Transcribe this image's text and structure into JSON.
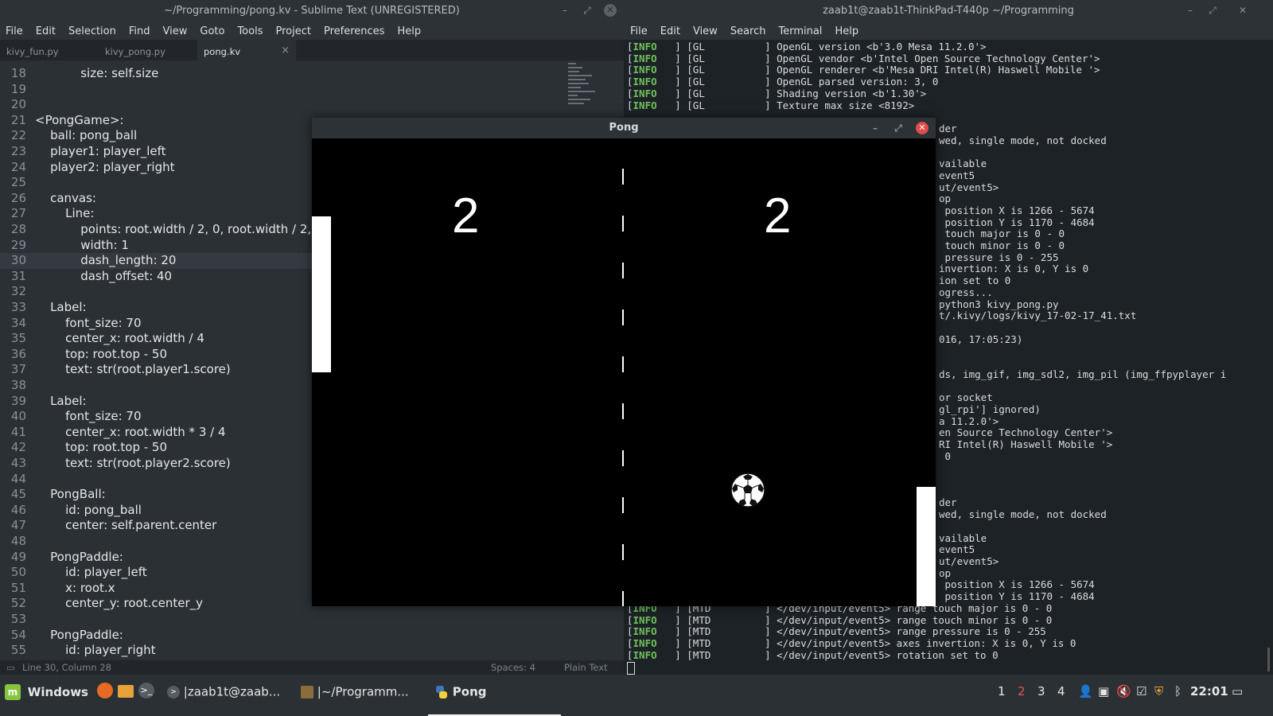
{
  "sublime": {
    "title": "~/Programming/pong.kv - Sublime Text (UNREGISTERED)",
    "menu": [
      "File",
      "Edit",
      "Selection",
      "Find",
      "View",
      "Goto",
      "Tools",
      "Project",
      "Preferences",
      "Help"
    ],
    "tabs": [
      {
        "label": "kivy_fun.py",
        "active": false
      },
      {
        "label": "kivy_pong.py",
        "active": false
      },
      {
        "label": "pong.kv",
        "active": true
      }
    ],
    "current_line": 30,
    "lines": [
      {
        "n": "18",
        "t": "            size: self.size"
      },
      {
        "n": "19",
        "t": ""
      },
      {
        "n": "20",
        "t": ""
      },
      {
        "n": "21",
        "t": "<PongGame>:"
      },
      {
        "n": "22",
        "t": "    ball: pong_ball"
      },
      {
        "n": "23",
        "t": "    player1: player_left"
      },
      {
        "n": "24",
        "t": "    player2: player_right"
      },
      {
        "n": "25",
        "t": ""
      },
      {
        "n": "26",
        "t": "    canvas:"
      },
      {
        "n": "27",
        "t": "        Line:"
      },
      {
        "n": "28",
        "t": "            points: root.width / 2, 0, root.width / 2,"
      },
      {
        "n": "29",
        "t": "            width: 1"
      },
      {
        "n": "30",
        "t": "            dash_length: 20"
      },
      {
        "n": "31",
        "t": "            dash_offset: 40"
      },
      {
        "n": "32",
        "t": ""
      },
      {
        "n": "33",
        "t": "    Label:"
      },
      {
        "n": "34",
        "t": "        font_size: 70"
      },
      {
        "n": "35",
        "t": "        center_x: root.width / 4"
      },
      {
        "n": "36",
        "t": "        top: root.top - 50"
      },
      {
        "n": "37",
        "t": "        text: str(root.player1.score)"
      },
      {
        "n": "38",
        "t": ""
      },
      {
        "n": "39",
        "t": "    Label:"
      },
      {
        "n": "40",
        "t": "        font_size: 70"
      },
      {
        "n": "41",
        "t": "        center_x: root.width * 3 / 4"
      },
      {
        "n": "42",
        "t": "        top: root.top - 50"
      },
      {
        "n": "43",
        "t": "        text: str(root.player2.score)"
      },
      {
        "n": "44",
        "t": ""
      },
      {
        "n": "45",
        "t": "    PongBall:"
      },
      {
        "n": "46",
        "t": "        id: pong_ball"
      },
      {
        "n": "47",
        "t": "        center: self.parent.center"
      },
      {
        "n": "48",
        "t": ""
      },
      {
        "n": "49",
        "t": "    PongPaddle:"
      },
      {
        "n": "50",
        "t": "        id: player_left"
      },
      {
        "n": "51",
        "t": "        x: root.x"
      },
      {
        "n": "52",
        "t": "        center_y: root.center_y"
      },
      {
        "n": "53",
        "t": ""
      },
      {
        "n": "54",
        "t": "    PongPaddle:"
      },
      {
        "n": "55",
        "t": "        id: player_right"
      }
    ],
    "status": {
      "position": "Line 30, Column 28",
      "spaces": "Spaces: 4",
      "syntax": "Plain Text"
    }
  },
  "terminal": {
    "title": "zaab1t@zaab1t-ThinkPad-T440p ~/Programming",
    "menu": [
      "File",
      "Edit",
      "View",
      "Search",
      "Terminal",
      "Help"
    ],
    "top_lines": [
      {
        "tag": "INFO",
        "rest": "   ] [GL          ] OpenGL version <b'3.0 Mesa 11.2.0'>"
      },
      {
        "tag": "INFO",
        "rest": "   ] [GL          ] OpenGL vendor <b'Intel Open Source Technology Center'>"
      },
      {
        "tag": "INFO",
        "rest": "   ] [GL          ] OpenGL renderer <b'Mesa DRI Intel(R) Haswell Mobile '>"
      },
      {
        "tag": "INFO",
        "rest": "   ] [GL          ] OpenGL parsed version: 3, 0"
      },
      {
        "tag": "INFO",
        "rest": "   ] [GL          ] Shading version <b'1.30'>"
      },
      {
        "tag": "INFO",
        "rest": "   ] [GL          ] Texture max size <8192>"
      }
    ],
    "right_fragments": [
      "der",
      "wed, single mode, not docked",
      "",
      "vailable",
      "event5",
      "ut/event5>",
      "op",
      " position X is 1266 - 5674",
      " position Y is 1170 - 4684",
      " touch major is 0 - 0",
      " touch minor is 0 - 0",
      " pressure is 0 - 255",
      "invertion: X is 0, Y is 0",
      "ion set to 0",
      "ogress...",
      "python3 kivy_pong.py",
      "t/.kivy/logs/kivy_17-02-17_41.txt",
      "",
      "016, 17:05:23)",
      "",
      "",
      "ds, img_gif, img_sdl2, img_pil (img_ffpyplayer i",
      "",
      "or socket",
      "gl_rpi'] ignored)",
      "a 11.2.0'>",
      "en Source Technology Center'>",
      "RI Intel(R) Haswell Mobile '>",
      " 0",
      "",
      "",
      "",
      "der",
      "wed, single mode, not docked",
      "",
      "vailable",
      "event5",
      "ut/event5>",
      "op",
      " position X is 1266 - 5674",
      " position Y is 1170 - 4684"
    ],
    "bottom_lines": [
      {
        "tag": "INFO",
        "rest": "   ] [MTD         ] </dev/input/event5> range touch major is 0 - 0"
      },
      {
        "tag": "INFO",
        "rest": "   ] [MTD         ] </dev/input/event5> range touch minor is 0 - 0"
      },
      {
        "tag": "INFO",
        "rest": "   ] [MTD         ] </dev/input/event5> range pressure is 0 - 255"
      },
      {
        "tag": "INFO",
        "rest": "   ] [MTD         ] </dev/input/event5> axes invertion: X is 0, Y is 0"
      },
      {
        "tag": "INFO",
        "rest": "   ] [MTD         ] </dev/input/event5> rotation set to 0"
      }
    ]
  },
  "pong": {
    "title": "Pong",
    "score_left": "2",
    "score_right": "2"
  },
  "taskbar": {
    "menu_label": "Windows",
    "tasks": [
      {
        "label": "|zaab1t@zaab...",
        "icon": "terminal-icon"
      },
      {
        "label": "|~/Programm...",
        "icon": "sublime-icon"
      },
      {
        "label": "Pong",
        "icon": "python-icon",
        "active": true
      }
    ],
    "workspaces": [
      "1",
      "2",
      "3",
      "4"
    ],
    "active_workspace": "2",
    "clock": "22:01"
  }
}
